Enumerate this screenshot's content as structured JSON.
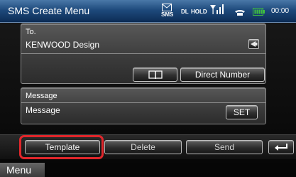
{
  "header": {
    "title": "SMS Create Menu",
    "sms_label": "SMS",
    "dl_label": "DL",
    "hold_label": "HOLD",
    "time": "00:00"
  },
  "to_section": {
    "label": "To.",
    "value": "KENWOOD Design",
    "direct_number_label": "Direct Number",
    "phonebook_icon": "book-icon",
    "back_icon": "left-arrow-icon"
  },
  "message_section": {
    "label": "Message",
    "value": "Message",
    "set_label": "SET"
  },
  "bottom_bar": {
    "template_label": "Template",
    "delete_label": "Delete",
    "send_label": "Send",
    "return_icon": "return-arrow-icon"
  },
  "menu_tab": {
    "label": "Menu"
  },
  "colors": {
    "status_bar": "#1e4a7c",
    "highlight": "#e0262b",
    "battery": "#3fbf3f"
  }
}
